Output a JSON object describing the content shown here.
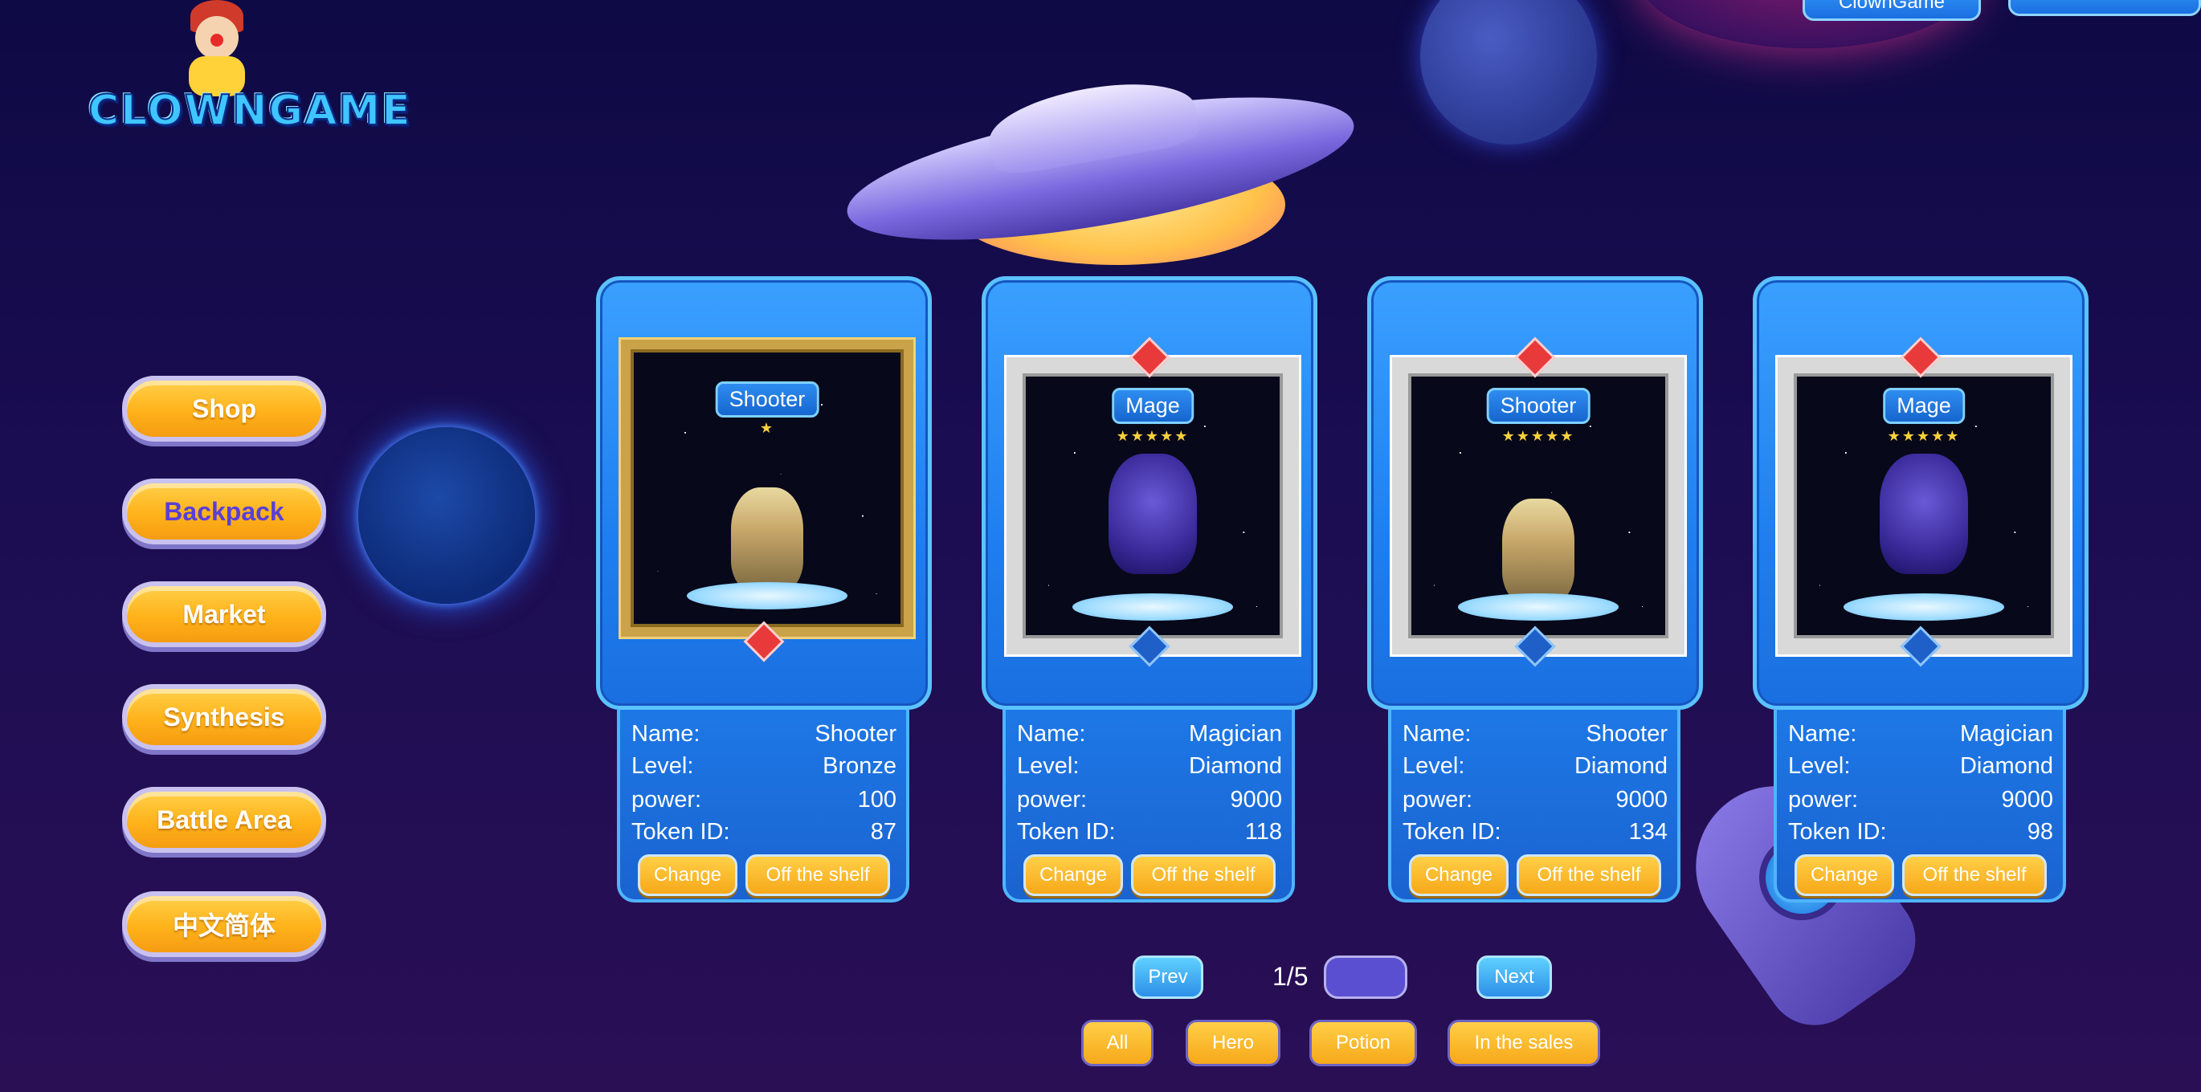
{
  "brand": {
    "logo_text": "CLOWNGAME",
    "top_tab": "ClownGame"
  },
  "nav": {
    "items": [
      {
        "label": "Shop",
        "active": false
      },
      {
        "label": "Backpack",
        "active": true
      },
      {
        "label": "Market",
        "active": false
      },
      {
        "label": "Synthesis",
        "active": false
      },
      {
        "label": "Battle Area",
        "active": false
      },
      {
        "label": "中文简体",
        "active": false
      }
    ]
  },
  "labels": {
    "name": "Name:",
    "level": "Level:",
    "power": "power:",
    "token": "Token ID:"
  },
  "cards": [
    {
      "class_badge": "Shooter",
      "stars": "★",
      "name": "Shooter",
      "level": "Bronze",
      "power": "100",
      "token_id": "87",
      "change": "Change",
      "off_shelf": "Off the shelf"
    },
    {
      "class_badge": "Mage",
      "stars": "★★★★★",
      "name": "Magician",
      "level": "Diamond",
      "power": "9000",
      "token_id": "118",
      "change": "Change",
      "off_shelf": "Off the shelf"
    },
    {
      "class_badge": "Shooter",
      "stars": "★★★★★",
      "name": "Shooter",
      "level": "Diamond",
      "power": "9000",
      "token_id": "134",
      "change": "Change",
      "off_shelf": "Off the shelf"
    },
    {
      "class_badge": "Mage",
      "stars": "★★★★★",
      "name": "Magician",
      "level": "Diamond",
      "power": "9000",
      "token_id": "98",
      "change": "Change",
      "off_shelf": "Off the shelf"
    }
  ],
  "pagination": {
    "prev": "Prev",
    "page": "1/5",
    "page_input": "",
    "next": "Next"
  },
  "filters": {
    "all": "All",
    "hero": "Hero",
    "potion": "Potion",
    "in_sales": "In the sales"
  },
  "colors": {
    "bg": "#140c4c",
    "button_yellow": "#ffb21a",
    "card_blue": "#1f7ff0",
    "active_text": "#5a3fd6"
  }
}
